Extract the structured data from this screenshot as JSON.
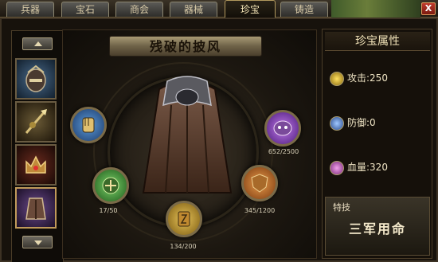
{
  "tabs": [
    {
      "label": "兵器",
      "active": false
    },
    {
      "label": "宝石",
      "active": false
    },
    {
      "label": "商会",
      "active": false
    },
    {
      "label": "器械",
      "active": false
    },
    {
      "label": "珍宝",
      "active": true
    },
    {
      "label": "铸造",
      "active": false
    }
  ],
  "close_label": "X",
  "item": {
    "title": "残破的披风"
  },
  "slots": [
    {
      "name": "helmet-icon",
      "color": "blue"
    },
    {
      "name": "spear-icon",
      "color": "gold"
    },
    {
      "name": "crown-icon",
      "color": "red"
    },
    {
      "name": "cloak-icon",
      "color": "purple"
    }
  ],
  "orbs": [
    {
      "name": "gauntlet-orb",
      "color": "blue",
      "label": ""
    },
    {
      "name": "emblem-green-orb",
      "color": "green",
      "label": "17/50"
    },
    {
      "name": "rune-gold-orb",
      "color": "gold",
      "label": "134/200"
    },
    {
      "name": "shield-orange-orb",
      "color": "orange",
      "label": "345/1200"
    },
    {
      "name": "mask-purple-orb",
      "color": "purple",
      "label": "652/2500"
    }
  ],
  "attributes": {
    "header": "珍宝属性",
    "attack": "攻击:250",
    "defense": "防御:0",
    "hp": "血量:320"
  },
  "skill": {
    "title": "特技",
    "name": "三军用命"
  },
  "colors": {
    "accent": "#b39a5e",
    "panel_bg": "#15100a",
    "text": "#efe4c4"
  }
}
